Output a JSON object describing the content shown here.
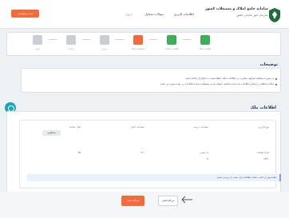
{
  "header": {
    "title": "سامانه جامع املاک و مستغلات کشور",
    "subtitle": "سازمان امور مالیاتی کشور",
    "nav": [
      "اطلاعات کاربری",
      "سوالات متداول",
      "خروج"
    ],
    "action_button": "ثبت درخواست"
  },
  "steps": [
    {
      "label": "اطلاعات ملک",
      "state": "done"
    },
    {
      "label": "اطلاعات مالکیت",
      "state": "done"
    },
    {
      "label": "مشخصات ملک",
      "state": "active"
    },
    {
      "label": "بررسی",
      "state": "pending"
    },
    {
      "label": "پرداخت",
      "state": "pending"
    },
    {
      "label": "پایان",
      "state": "pending"
    }
  ],
  "info": {
    "title": "توضیحات",
    "lines": [
      "در صورت مشاهده هرگونه مغایرت در اطلاعات ملک، لطفا نسبت به اصلاح آن اقدام نمایید.",
      "مالیات متعلقه بر اساس اطلاعات ثبت شده محاسبه خواهد شد و مسئولیت صحت اطلاعات بر عهده مودی می باشد."
    ]
  },
  "form": {
    "title": "اطلاعات ملک",
    "fields": [
      {
        "label": "نوع کاربری",
        "value": "مسکونی"
      },
      {
        "label": "مساحت عرصه",
        "value": "۱۲۰"
      },
      {
        "label": "مساحت اعیان",
        "value": "۹۵"
      },
      {
        "label": "سال ساخت",
        "value": "۱۳۹۰"
      },
      {
        "label": "تعداد طبقات",
        "value": "۴"
      },
      {
        "label": "کد پستی",
        "value": ""
      }
    ],
    "pill": "مسکونی",
    "notice": "لطفا پیش از ادامه، صحت اطلاعات وارد شده را بررسی نمایید."
  },
  "footer": {
    "prev": "مرحله قبلی",
    "next": "مرحله بعدی"
  },
  "colors": {
    "accent": "#f26b3a",
    "done": "#3fae5a",
    "active": "#f26b3a",
    "pending": "#c9ced6",
    "fab": "#1aa7b6"
  }
}
